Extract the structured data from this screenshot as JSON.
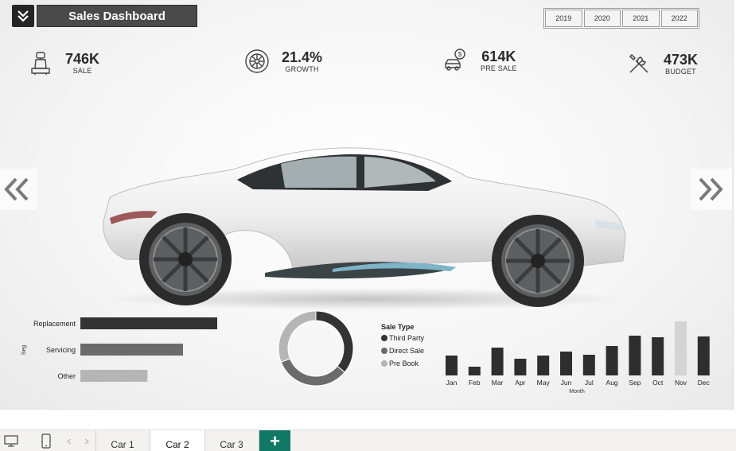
{
  "header": {
    "title": "Sales Dashboard",
    "collapse_icon": "double-chevron-down-icon"
  },
  "year_slicer": {
    "years": [
      "2019",
      "2020",
      "2021",
      "2022"
    ]
  },
  "kpis": [
    {
      "icon": "car-seat-icon",
      "value": "746K",
      "label": "SALE"
    },
    {
      "icon": "tire-icon",
      "value": "21.4%",
      "label": "GROWTH"
    },
    {
      "icon": "car-dollar-icon",
      "value": "614K",
      "label": "PRE SALE"
    },
    {
      "icon": "tools-icon",
      "value": "473K",
      "label": "BUDGET"
    }
  ],
  "navigation": {
    "prev_icon": "double-chevron-left-icon",
    "next_icon": "double-chevron-right-icon"
  },
  "colors": {
    "dark": "#333333",
    "mid": "#6b6b6b",
    "light": "#b5b5b5",
    "accent": "#117865"
  },
  "chart_data": [
    {
      "type": "bar",
      "orientation": "horizontal",
      "categories": [
        "Replacement",
        "Servicing",
        "Other"
      ],
      "values": [
        100,
        75,
        49
      ],
      "ylabel": "Seg",
      "colors": [
        "#333333",
        "#6b6b6b",
        "#b5b5b5"
      ]
    },
    {
      "type": "pie",
      "style": "donut",
      "categories": [
        "Third Party",
        "Direct Sale",
        "Pre Book"
      ],
      "values": [
        36,
        33,
        31
      ],
      "legend_title": "Sale Type",
      "colors": [
        "#333333",
        "#6b6b6b",
        "#b5b5b5"
      ]
    },
    {
      "type": "bar",
      "categories": [
        "Jan",
        "Feb",
        "Mar",
        "Apr",
        "May",
        "Jun",
        "Jul",
        "Aug",
        "Sep",
        "Oct",
        "Nov",
        "Dec"
      ],
      "values": [
        25,
        11,
        35,
        21,
        25,
        30,
        26,
        37,
        50,
        48,
        68,
        49
      ],
      "xlabel": "Month",
      "highlight_index": 10,
      "colors": [
        "#2e2e2e",
        "#d4d4d4"
      ]
    }
  ],
  "statusbar": {
    "desktop_icon": "desktop-view-icon",
    "mobile_icon": "mobile-view-icon",
    "prev_icon": "scroll-left-icon",
    "next_icon": "scroll-right-icon",
    "tabs": [
      "Car 1",
      "Car 2",
      "Car 3"
    ],
    "active_tab": "Car 2",
    "add_label": "+"
  }
}
